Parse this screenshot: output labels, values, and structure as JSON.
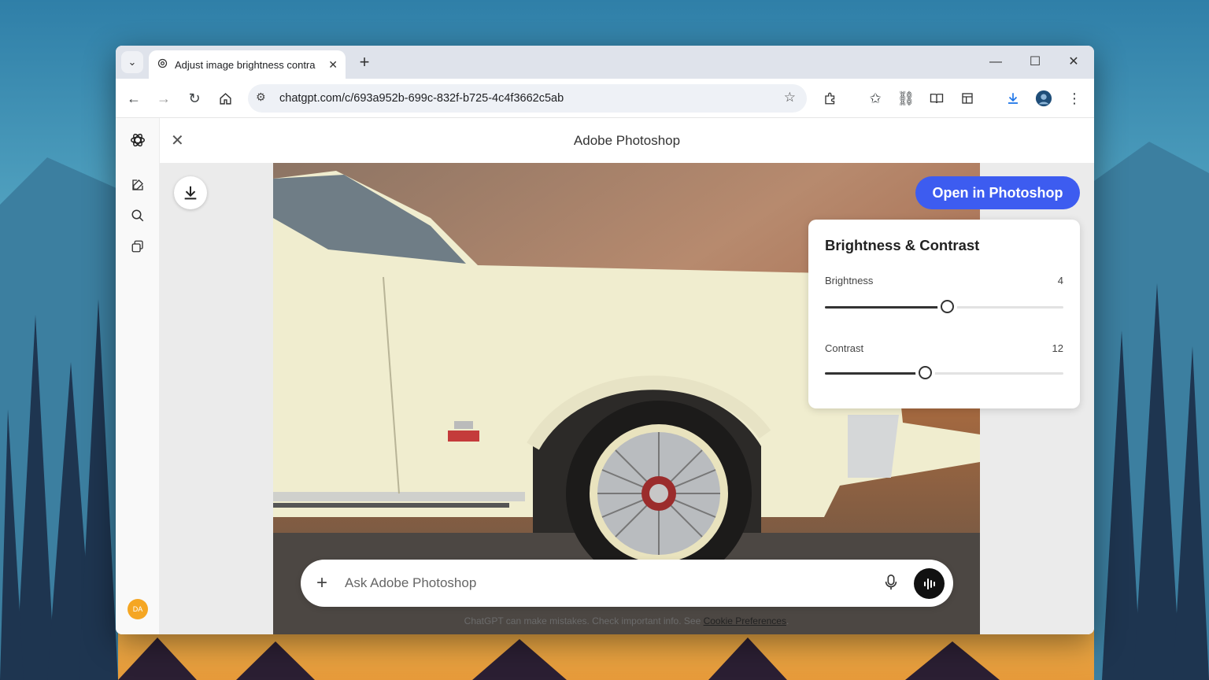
{
  "browser": {
    "tab_title": "Adjust image brightness contra",
    "url": "chatgpt.com/c/693a952b-699c-832f-b725-4c4f3662c5ab"
  },
  "app": {
    "title": "Adobe Photoshop",
    "open_button": "Open in Photoshop"
  },
  "adjustments": {
    "title": "Brightness & Contrast",
    "brightness": {
      "label": "Brightness",
      "value": "4",
      "level": 0.51
    },
    "contrast": {
      "label": "Contrast",
      "value": "12",
      "level": 0.42
    }
  },
  "composer": {
    "placeholder": "Ask Adobe Photoshop"
  },
  "disclaimer": {
    "text": "ChatGPT can make mistakes. Check important info. See",
    "link": "Cookie Preferences",
    "end": "."
  },
  "user": {
    "initials": "DA"
  },
  "colors": {
    "accent": "#3d5cf0",
    "avatar": "#f5a623"
  }
}
